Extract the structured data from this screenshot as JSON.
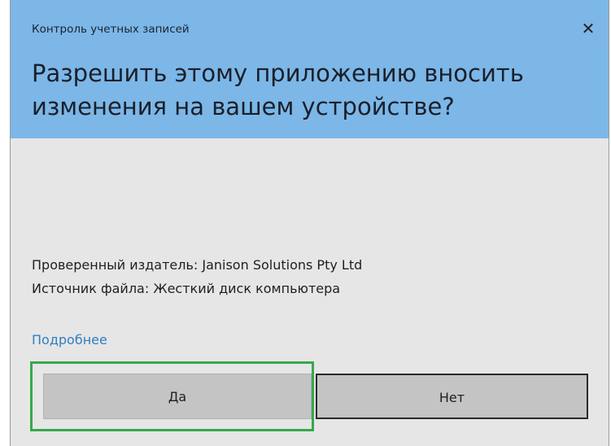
{
  "dialog": {
    "header_title": "Контроль учетных записей",
    "close_icon_glyph": "✕",
    "question": "Разрешить этому приложению вносить изменения на вашем устройстве?",
    "publisher": "Проверенный издатель: Janison Solutions Pty Ltd",
    "file_source": "Источник файла: Жесткий диск компьютера",
    "more_link": "Подробнее",
    "yes_label": "Да",
    "no_label": "Нет"
  },
  "colors": {
    "header_bg": "#7cb7e7",
    "body_bg": "#e6e6e6",
    "link": "#2f7fc1",
    "highlight": "#36a84c"
  },
  "icons": {
    "close": "close-icon"
  }
}
